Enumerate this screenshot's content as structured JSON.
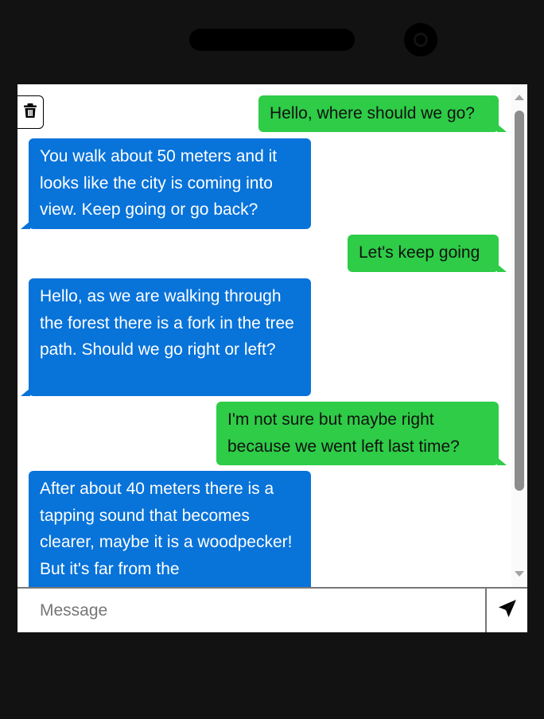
{
  "messages": [
    {
      "sender": "user",
      "text": "Hello, where should we go?"
    },
    {
      "sender": "bot",
      "text": "You walk about 50 meters and it looks like the city is coming into view. Keep going or go back?"
    },
    {
      "sender": "user",
      "text": "Let's keep going"
    },
    {
      "sender": "bot",
      "text": "Hello, as we are walking through the forest there is a fork in the tree path. Should we go right or left?"
    },
    {
      "sender": "user",
      "text": "I'm not sure but maybe right because we went left last time?"
    },
    {
      "sender": "bot",
      "text": "After about 40 meters there is a tapping sound that becomes clearer, maybe it is a woodpecker! But it's far from the"
    }
  ],
  "composer": {
    "placeholder": "Message",
    "value": ""
  },
  "icons": {
    "clear": "trash-icon",
    "send": "paper-plane-icon"
  },
  "colors": {
    "user_bubble": "#2ecc47",
    "bot_bubble": "#0873d9",
    "frame": "#121212"
  }
}
